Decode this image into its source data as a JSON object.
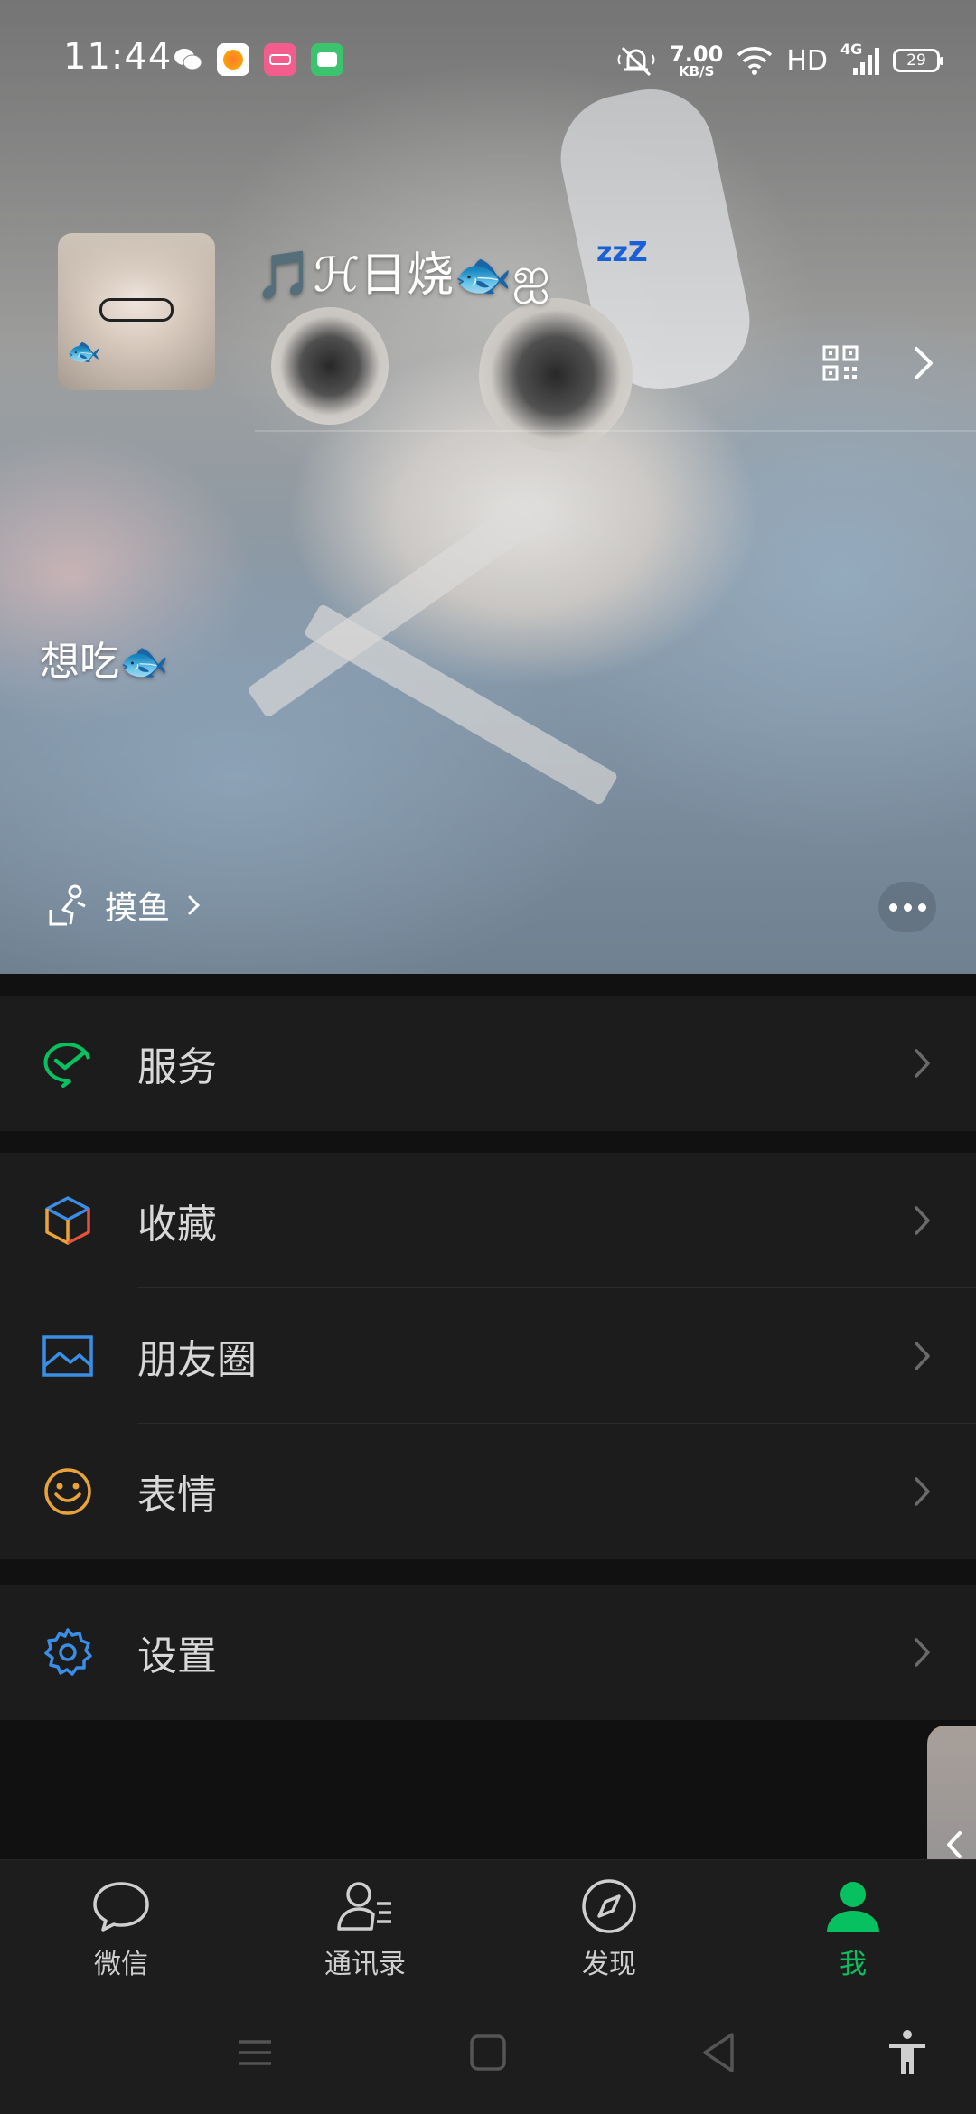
{
  "status_bar": {
    "time": "11:44",
    "network_speed_value": "7.00",
    "network_speed_unit": "KB/S",
    "hd": "HD",
    "network_type": "4G",
    "battery": "29"
  },
  "profile": {
    "nickname": "🎵ℋ日烧🐟ஐ",
    "nickname_suffix": "zzZ",
    "signature": "想吃🐟",
    "status_label": "摸鱼"
  },
  "menu": {
    "groups": [
      [
        {
          "label": "服务",
          "icon": "wechat-pay-icon",
          "color": "#07c160"
        }
      ],
      [
        {
          "label": "收藏",
          "icon": "favorites-cube-icon",
          "color": "#3a8ee6"
        },
        {
          "label": "朋友圈",
          "icon": "moments-image-icon",
          "color": "#3a8ee6"
        },
        {
          "label": "表情",
          "icon": "sticker-smile-icon",
          "color": "#e9a33b"
        }
      ],
      [
        {
          "label": "设置",
          "icon": "settings-gear-icon",
          "color": "#3a8ee6"
        }
      ]
    ]
  },
  "tabbar": {
    "tabs": [
      {
        "label": "微信",
        "icon": "chat-bubble-icon",
        "active": false
      },
      {
        "label": "通讯录",
        "icon": "contacts-icon",
        "active": false
      },
      {
        "label": "发现",
        "icon": "compass-icon",
        "active": false
      },
      {
        "label": "我",
        "icon": "me-person-icon",
        "active": true
      }
    ],
    "active_color": "#07c160"
  },
  "system_nav": {
    "buttons": [
      "menu-icon",
      "home-square-icon",
      "back-triangle-icon",
      "accessibility-icon"
    ]
  }
}
